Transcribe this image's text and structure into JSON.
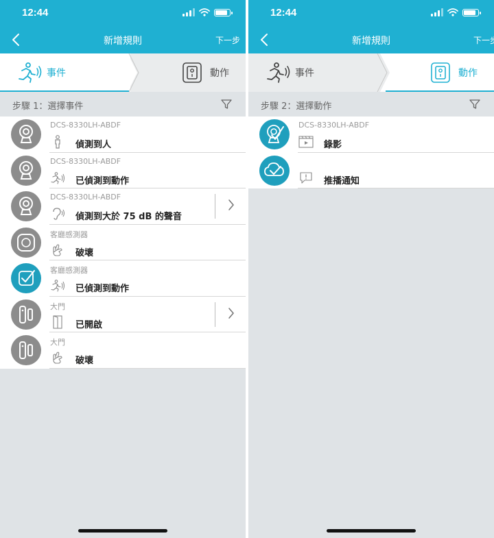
{
  "status": {
    "time": "12:44"
  },
  "nav": {
    "title": "新增規則",
    "next": "下一步"
  },
  "tabs": {
    "event": "事件",
    "action": "動作"
  },
  "left": {
    "step": "步驟 1：選擇事件",
    "rows": [
      {
        "device": "DCS-8330LH-ABDF",
        "text": "偵測到人",
        "avatar": "camera-icon",
        "type": "person-icon"
      },
      {
        "device": "DCS-8330LH-ABDF",
        "text": "已偵測到動作",
        "avatar": "camera-icon",
        "type": "motion-icon"
      },
      {
        "device": "DCS-8330LH-ABDF",
        "text": "偵測到大於 75 dB 的聲音",
        "avatar": "camera-icon",
        "type": "sound-icon"
      },
      {
        "device": "客廳感測器",
        "text": "破壞",
        "avatar": "sensor-icon",
        "type": "tamper-icon"
      },
      {
        "device": "客廳感測器",
        "text": "已偵測到動作",
        "avatar": "check-icon",
        "type": "motion-icon"
      },
      {
        "device": "大門",
        "text": "已開啟",
        "avatar": "door-sensor-icon",
        "type": "door-icon"
      },
      {
        "device": "大門",
        "text": "破壞",
        "avatar": "door-sensor-icon",
        "type": "tamper-icon"
      }
    ]
  },
  "right": {
    "step": "步驟 2：選擇動作",
    "rows": [
      {
        "device": "DCS-8330LH-ABDF",
        "text": "錄影",
        "avatar": "camera-check-icon",
        "type": "video-icon"
      },
      {
        "device": "",
        "text": "推播通知",
        "avatar": "cloud-check-icon",
        "type": "notification-icon"
      }
    ]
  },
  "colors": {
    "accent": "#1fb0d2",
    "avatar_grey": "#8c8c8c",
    "avatar_teal": "#1f9fbd"
  }
}
